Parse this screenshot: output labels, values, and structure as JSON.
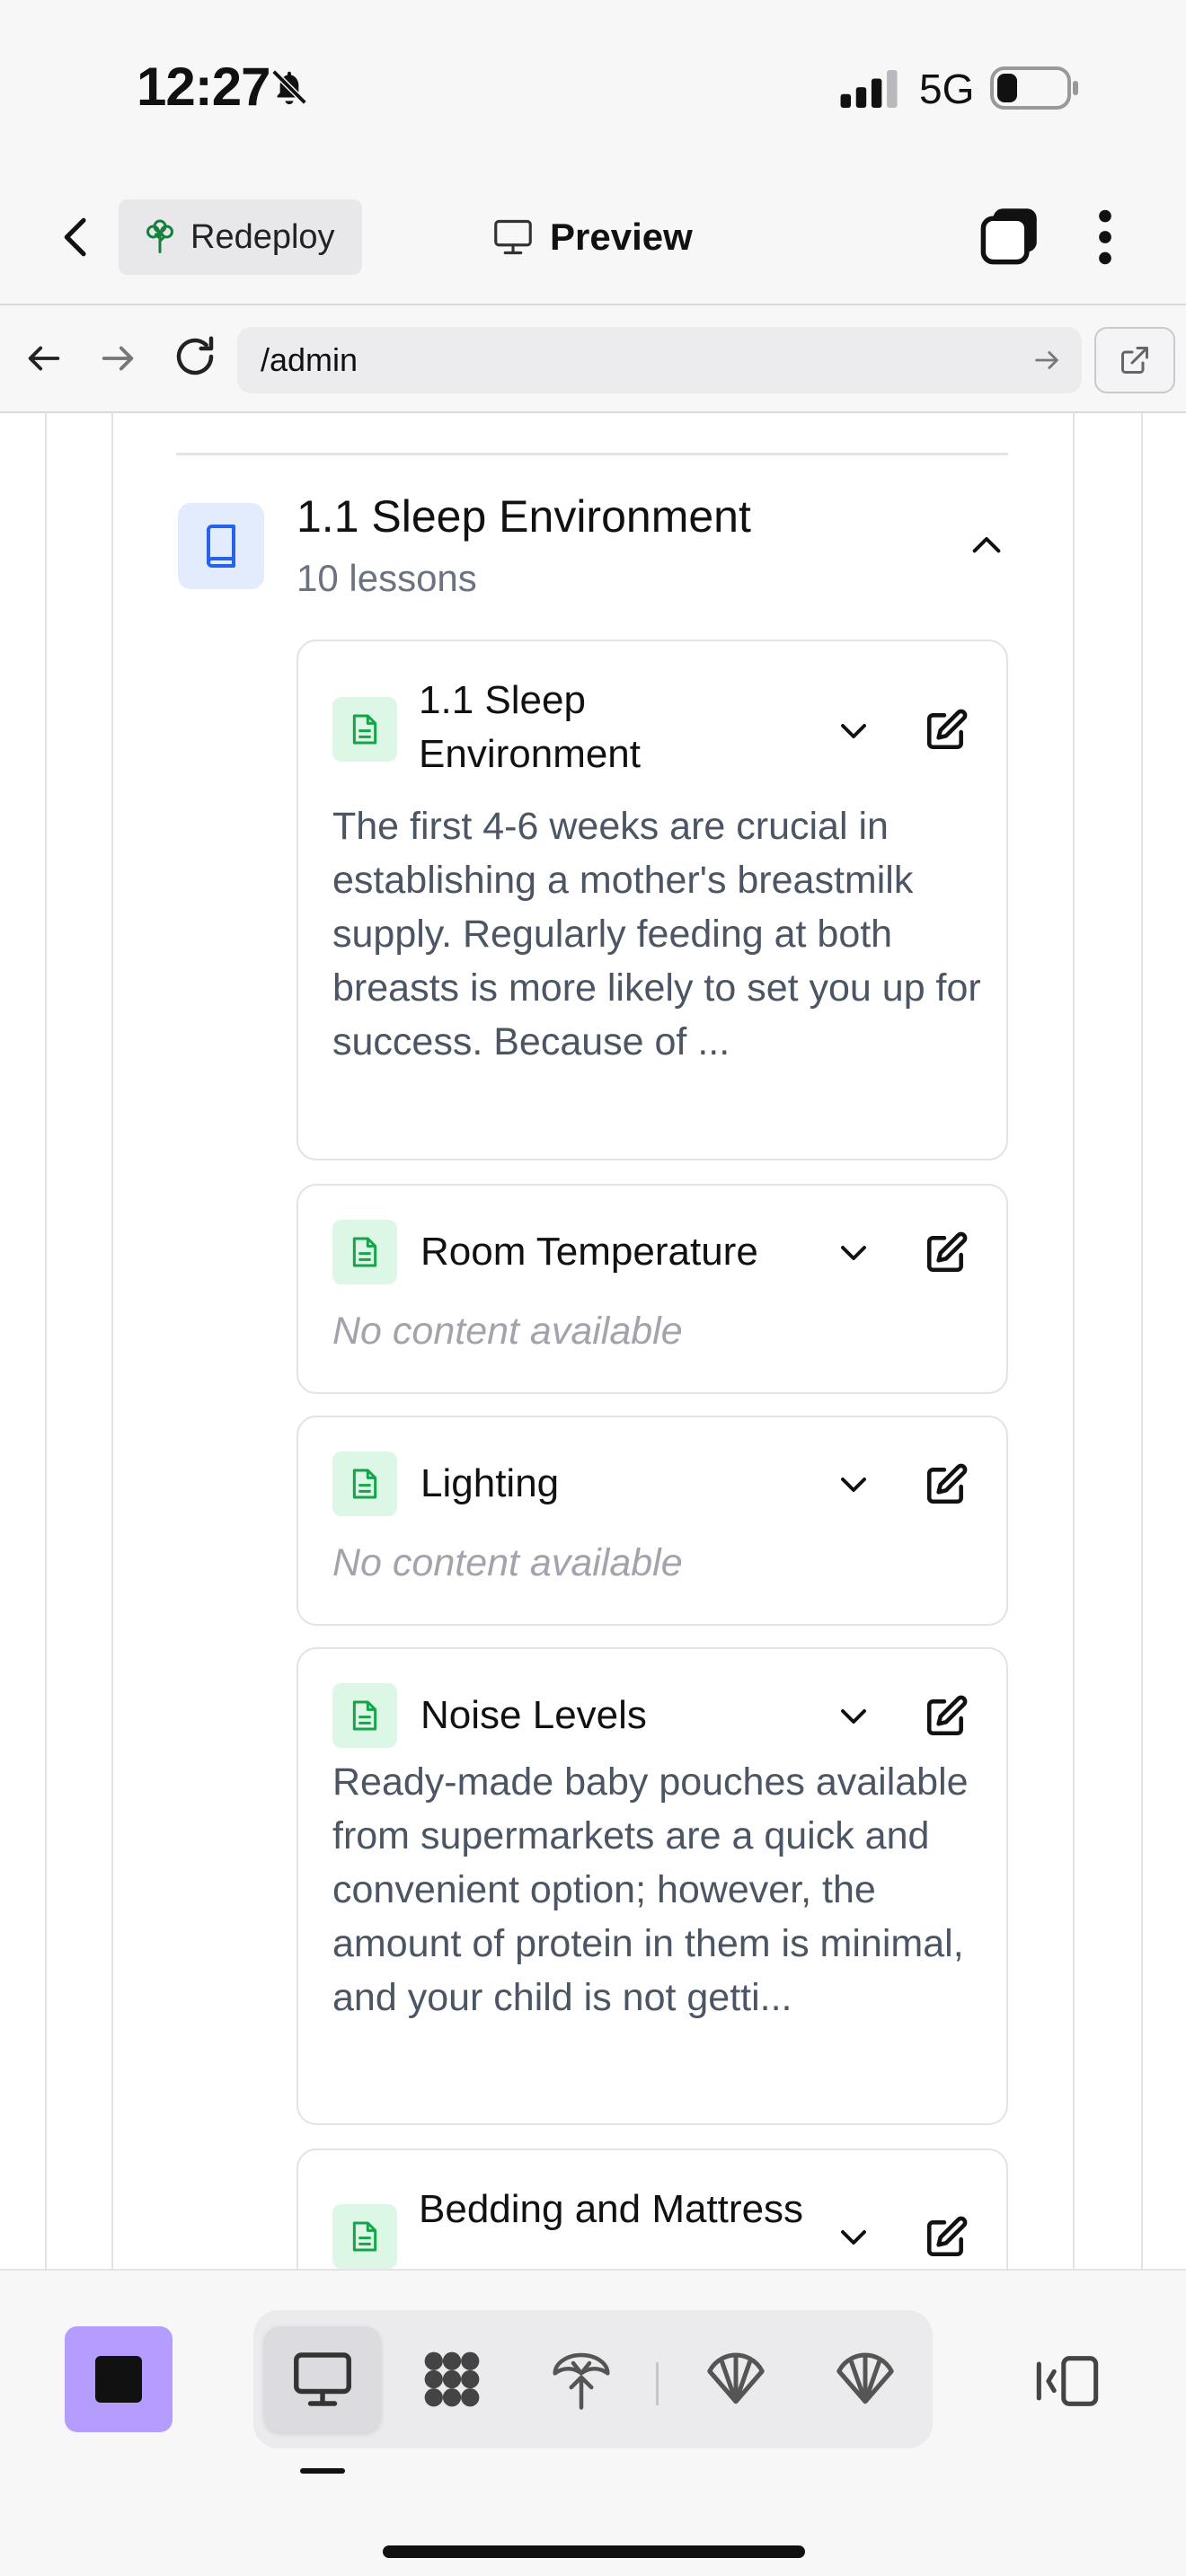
{
  "status_bar": {
    "time": "12:27",
    "network": "5G",
    "icons": [
      "bell-slash-icon",
      "signal-icon",
      "battery-icon"
    ]
  },
  "header": {
    "redeploy_label": "Redeploy",
    "preview_label": "Preview",
    "icons": [
      "chevron-left-icon",
      "tree-icon",
      "monitor-icon",
      "tabs-icon",
      "more-vertical-icon"
    ]
  },
  "browser": {
    "url": "/admin",
    "icons": [
      "arrow-left-icon",
      "arrow-right-icon",
      "reload-icon",
      "go-arrow-icon",
      "external-link-icon"
    ]
  },
  "module": {
    "title": "1.1 Sleep Environment",
    "lesson_count": "10 lessons",
    "expanded": true,
    "icon": "book-icon",
    "icon_bg": "#e3ecfd",
    "icon_color": "#2563eb"
  },
  "lessons": [
    {
      "title": "1.1 Sleep Environment",
      "preview": "The first 4-6 weeks are crucial in establishing a mother's breastmilk supply. Regularly feeding at both breasts is more likely to set you up for success. Because of ..."
    },
    {
      "title": "Room Temperature",
      "empty_text": "No content available"
    },
    {
      "title": "Lighting",
      "empty_text": "No content available"
    },
    {
      "title": "Noise Levels",
      "preview": "Ready-made baby pouches available from supermarkets are a quick and convenient option; however, the amount of protein in them is minimal, and your child is not getti..."
    },
    {
      "title": "Bedding and Mattress"
    }
  ],
  "lesson_icon": {
    "name": "document-icon",
    "bg": "#dcf7e6",
    "color": "#16a34a"
  },
  "toolbar": {
    "stop_color": "#b59cff",
    "modes": [
      "monitor-icon",
      "grid-icon",
      "tree-icon",
      "shell-icon",
      "shell-icon"
    ],
    "active_mode": 0,
    "panel_icon": "panel-toggle-icon"
  }
}
